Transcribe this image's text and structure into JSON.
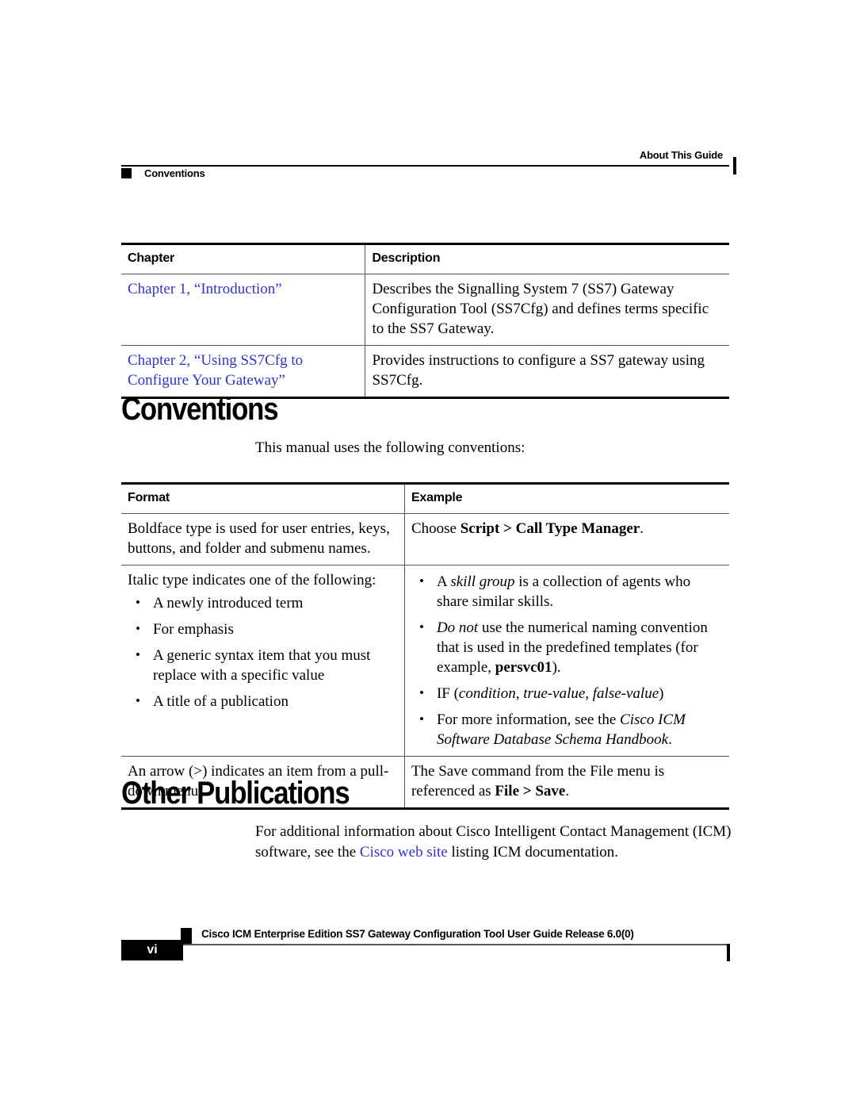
{
  "document": {
    "running_head": {
      "guide_label": "About This Guide",
      "section_label": "Conventions"
    },
    "footer": {
      "title": "Cisco ICM Enterprise Edition SS7 Gateway Configuration Tool User Guide Release 6.0(0)",
      "page_number": "vi"
    },
    "link_color": "#3333cc"
  },
  "chapter_table": {
    "headers": [
      "Chapter",
      "Description"
    ],
    "rows": [
      {
        "chapter": "Chapter 1, “Introduction”",
        "description": "Describes the Signalling System 7 (SS7) Gateway Configuration Tool (SS7Cfg) and defines terms specific to the SS7 Gateway."
      },
      {
        "chapter": "Chapter 2, “Using SS7Cfg to Configure Your Gateway”",
        "description": "Provides instructions to configure a SS7 gateway using SS7Cfg."
      }
    ]
  },
  "conventions_section": {
    "heading": "Conventions",
    "intro": "This manual uses the following conventions:",
    "table": {
      "headers": [
        "Format",
        "Example"
      ],
      "rows": [
        {
          "format_text": "Boldface type is used for user entries, keys, buttons, and folder and submenu names.",
          "example_lead": "Choose ",
          "example_bold": "Script > Call Type Manager",
          "example_tail": "."
        },
        {
          "format_text": "Italic type indicates one of the following:",
          "format_bullets": [
            "A newly introduced term",
            "For emphasis",
            "A generic syntax item that you must replace with a specific value",
            "A title of a publication"
          ],
          "example_bullets": {
            "b1_pre": "A ",
            "b1_italic": "skill group",
            "b1_post": " is a collection of agents who share similar skills.",
            "b2_italic": "Do not",
            "b2_post": " use the numerical naming convention that is used in the predefined templates (for example, ",
            "b2_bold": "persvc01",
            "b2_tail": ").",
            "b3_pre": "IF (",
            "b3_italic_1": "condition",
            "b3_sep_1": ", ",
            "b3_italic_2": "true-value",
            "b3_sep_2": ", ",
            "b3_italic_3": "false-value",
            "b3_tail": ")",
            "b4_pre": "For more information, see the ",
            "b4_italic": "Cisco ICM Software Database Schema Handbook",
            "b4_tail": "."
          }
        },
        {
          "format_text": "An arrow (>) indicates an item from a pull-down menu.",
          "example_lead": "The Save command from the File menu is referenced as ",
          "example_bold": "File > Save",
          "example_tail": "."
        }
      ]
    }
  },
  "other_publications_section": {
    "heading": "Other Publications",
    "paragraph_pre": "For additional information about Cisco Intelligent Contact Management (ICM) software, see the ",
    "link_text": "Cisco web site",
    "paragraph_post": " listing ICM documentation."
  }
}
